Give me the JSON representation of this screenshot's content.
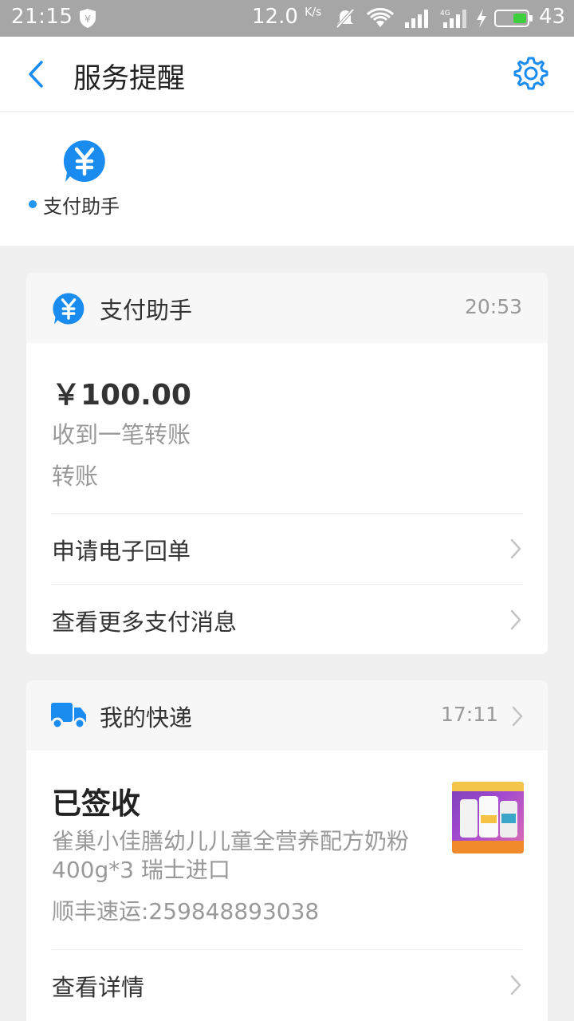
{
  "status_bar": {
    "time": "21:15",
    "speed": "12.0",
    "speed_unit": "K/s",
    "battery": "43"
  },
  "nav": {
    "title": "服务提醒"
  },
  "app_strip": {
    "label": "支付助手"
  },
  "payment_card": {
    "header_title": "支付助手",
    "header_time": "20:53",
    "amount": "￥100.00",
    "description": "收到一笔转账",
    "type": "转账",
    "rows": [
      {
        "label": "申请电子回单"
      },
      {
        "label": "查看更多支付消息"
      }
    ]
  },
  "delivery_card": {
    "header_title": "我的快递",
    "header_time": "17:11",
    "status": "已签收",
    "product": "雀巢小佳膳幼儿儿童全营养配方奶粉400g*3 瑞士进口",
    "tracking": "顺丰速运:259848893038",
    "rows": [
      {
        "label": "查看详情"
      }
    ]
  },
  "colors": {
    "accent": "#1a8cf0",
    "status_bar": "#a6a6a6",
    "background": "#f0f0f0"
  },
  "icons": [
    "shield-icon",
    "mute-icon",
    "wifi-icon",
    "signal-icon",
    "charging-icon",
    "battery-icon",
    "back-icon",
    "gear-icon",
    "yuan-icon",
    "truck-icon",
    "chevron-right-icon"
  ]
}
